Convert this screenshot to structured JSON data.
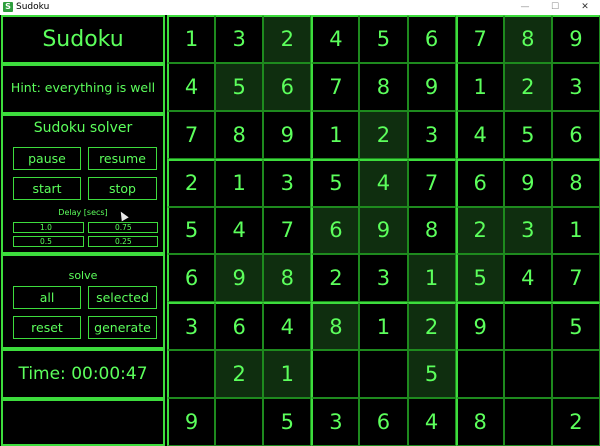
{
  "window": {
    "title": "Sudoku",
    "icon": "S",
    "minimize": "—",
    "maximize": "☐",
    "close": "✕"
  },
  "panel": {
    "app_title": "Sudoku",
    "hint": "Hint: everything is well",
    "solver_title": "Sudoku solver",
    "buttons": {
      "pause": "pause",
      "resume": "resume",
      "start": "start",
      "stop": "stop",
      "all": "all",
      "selected": "selected",
      "reset": "reset",
      "generate": "generate"
    },
    "delay_label": "Delay [secs]",
    "delay_options": [
      "1.0",
      "0.75",
      "0.5",
      "0.25"
    ],
    "solve_title": "solve",
    "time": "Time: 00:00:47"
  },
  "board": {
    "rows": [
      [
        "1",
        "3",
        "2",
        "4",
        "5",
        "6",
        "7",
        "8",
        "9"
      ],
      [
        "4",
        "5",
        "6",
        "7",
        "8",
        "9",
        "1",
        "2",
        "3"
      ],
      [
        "7",
        "8",
        "9",
        "1",
        "2",
        "3",
        "4",
        "5",
        "6"
      ],
      [
        "2",
        "1",
        "3",
        "5",
        "4",
        "7",
        "6",
        "9",
        "8"
      ],
      [
        "5",
        "4",
        "7",
        "6",
        "9",
        "8",
        "2",
        "3",
        "1"
      ],
      [
        "6",
        "9",
        "8",
        "2",
        "3",
        "1",
        "5",
        "4",
        "7"
      ],
      [
        "3",
        "6",
        "4",
        "8",
        "1",
        "2",
        "9",
        "",
        "5"
      ],
      [
        "",
        "2",
        "1",
        "",
        "",
        "5",
        "",
        "",
        ""
      ],
      [
        "9",
        "",
        "5",
        "3",
        "6",
        "4",
        "8",
        "",
        "2"
      ]
    ],
    "shaded": [
      [
        0,
        0,
        1,
        0,
        0,
        0,
        0,
        1,
        0
      ],
      [
        0,
        1,
        1,
        0,
        0,
        0,
        0,
        1,
        0
      ],
      [
        0,
        0,
        0,
        0,
        1,
        0,
        0,
        0,
        0
      ],
      [
        0,
        0,
        0,
        0,
        1,
        0,
        0,
        0,
        0
      ],
      [
        0,
        0,
        0,
        1,
        1,
        0,
        1,
        1,
        0
      ],
      [
        0,
        1,
        1,
        0,
        0,
        1,
        1,
        0,
        0
      ],
      [
        0,
        0,
        0,
        1,
        0,
        1,
        0,
        0,
        0
      ],
      [
        0,
        1,
        1,
        0,
        0,
        1,
        0,
        0,
        0
      ],
      [
        0,
        0,
        0,
        0,
        0,
        0,
        0,
        0,
        0
      ]
    ],
    "colors": {
      "digit": "#5cff5c",
      "grid": "#3ddc3d",
      "shade": "#0f2e0f"
    }
  }
}
